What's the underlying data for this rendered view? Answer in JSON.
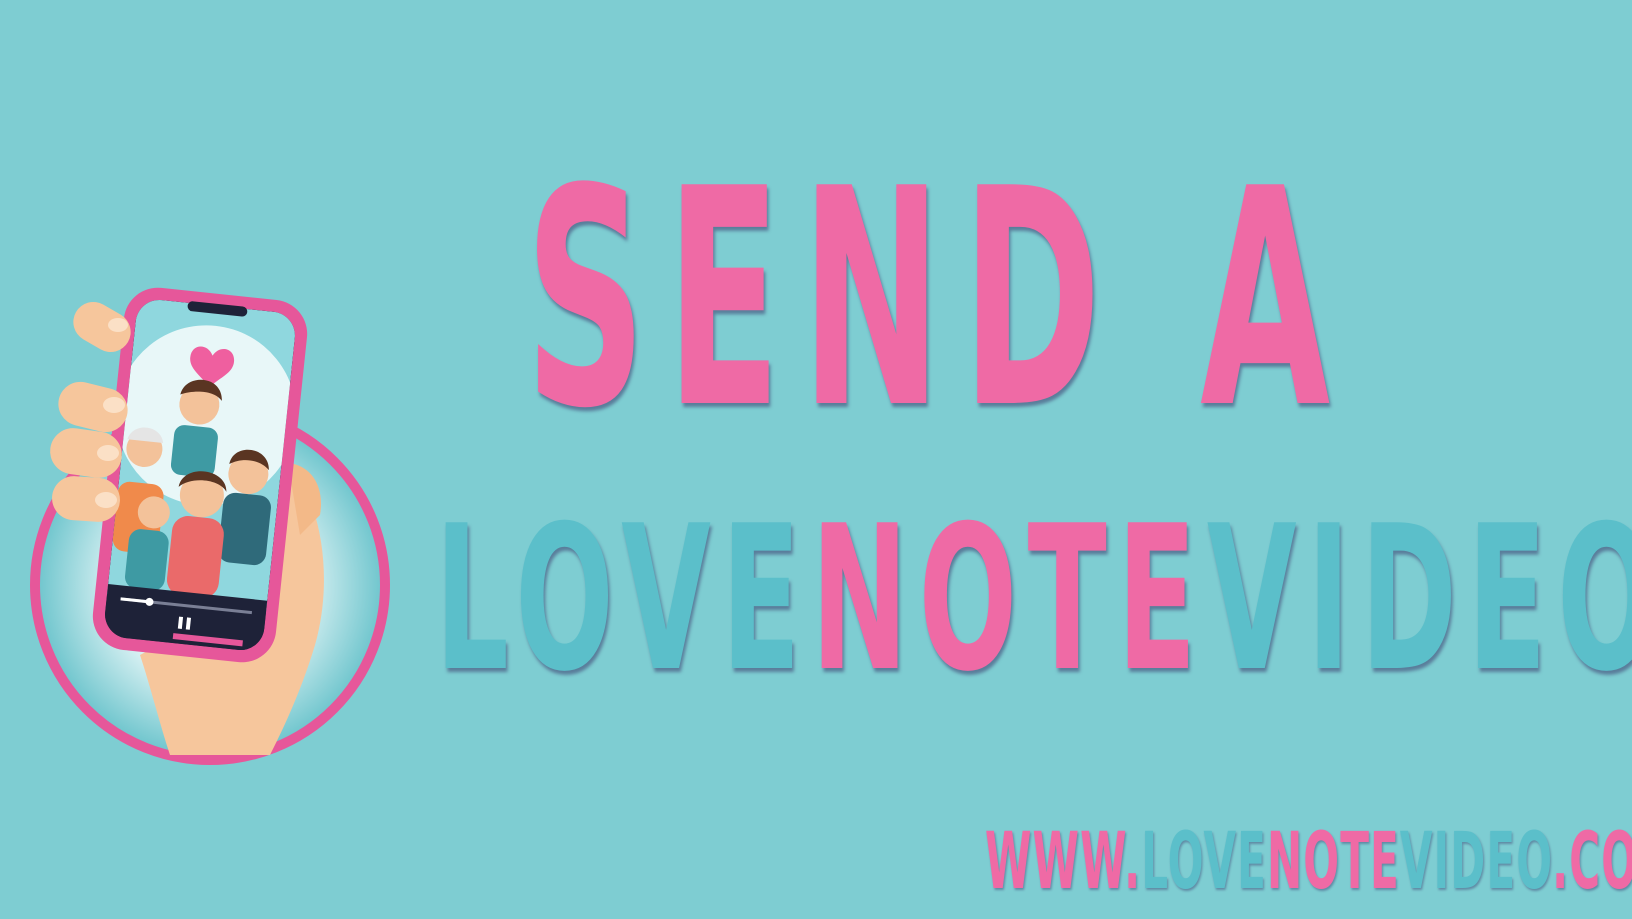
{
  "background_color": "#7ecdd2",
  "colors": {
    "pink": "#ef6aa5",
    "teal": "#5bbfca"
  },
  "headline": {
    "line1": "SEND A",
    "line2_parts": [
      {
        "text": "LOVE",
        "color": "teal"
      },
      {
        "text": "NOTE",
        "color": "pink"
      },
      {
        "text": "VIDEO",
        "color": "teal"
      }
    ]
  },
  "url": {
    "parts": [
      {
        "text": "WWW.",
        "color": "pink"
      },
      {
        "text": "LOVE",
        "color": "teal"
      },
      {
        "text": "NOTE",
        "color": "pink"
      },
      {
        "text": "VIDEO",
        "color": "teal"
      },
      {
        "text": ".COM",
        "color": "pink"
      }
    ]
  },
  "logo": {
    "icon": "hand-holding-phone-family-video-icon",
    "player_state": "playing",
    "progress": 0.22
  }
}
